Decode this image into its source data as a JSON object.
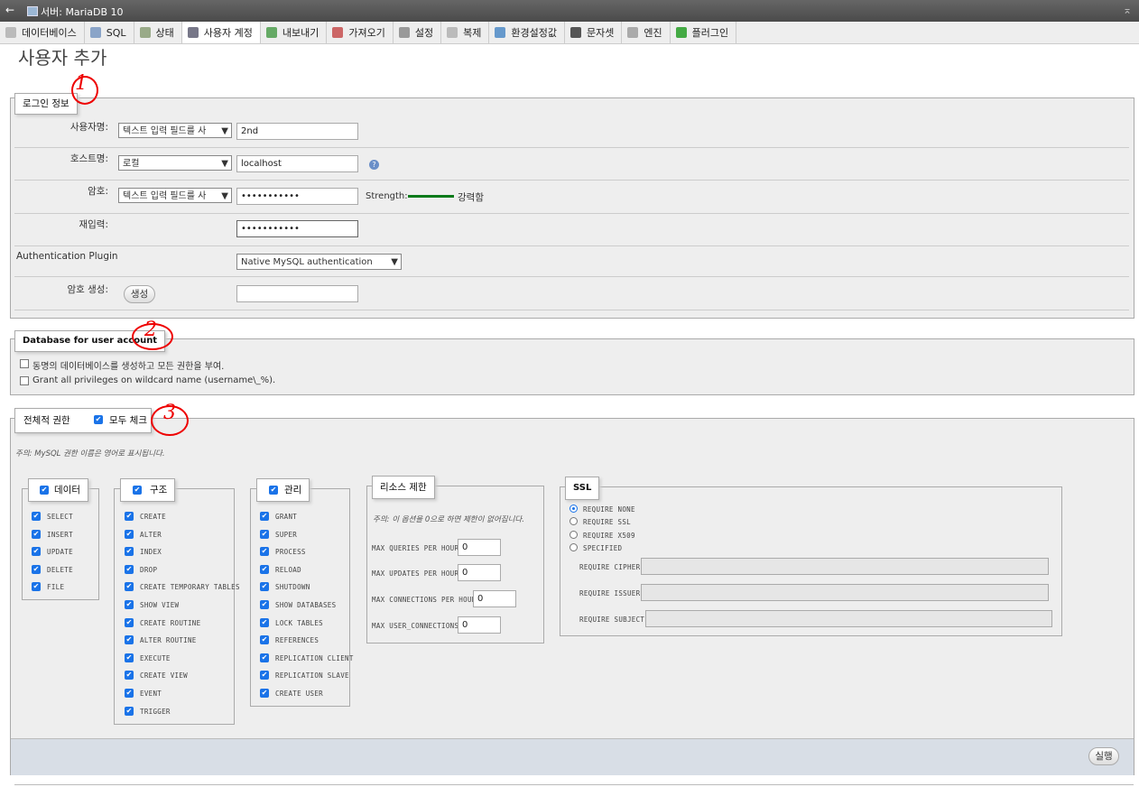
{
  "topbar": {
    "back": "←",
    "server": "서버: MariaDB 10",
    "collapse": "⌅"
  },
  "tabs": [
    {
      "label": "데이터베이스",
      "icon": "database-icon",
      "color": "#bbb"
    },
    {
      "label": "SQL",
      "icon": "sql-icon",
      "color": "#8aa4c8"
    },
    {
      "label": "상태",
      "icon": "status-icon",
      "color": "#9a8"
    },
    {
      "label": "사용자 계정",
      "icon": "users-icon",
      "color": "#778"
    },
    {
      "label": "내보내기",
      "icon": "export-icon",
      "color": "#6a6"
    },
    {
      "label": "가져오기",
      "icon": "import-icon",
      "color": "#c66"
    },
    {
      "label": "설정",
      "icon": "wrench-icon",
      "color": "#999"
    },
    {
      "label": "복제",
      "icon": "replication-icon",
      "color": "#bbb"
    },
    {
      "label": "환경설정값",
      "icon": "variables-icon",
      "color": "#69c"
    },
    {
      "label": "문자셋",
      "icon": "charset-icon",
      "color": "#555"
    },
    {
      "label": "엔진",
      "icon": "engine-icon",
      "color": "#aaa"
    },
    {
      "label": "플러그인",
      "icon": "plugin-icon",
      "color": "#4a4"
    }
  ],
  "page_title": "사용자 추가",
  "login": {
    "legend": "로그인 정보",
    "username_label": "사용자명:",
    "username_select": "텍스트 입력 필드를 사",
    "username_value": "2nd",
    "host_label": "호스트명:",
    "host_select": "로컬",
    "host_value": "localhost",
    "password_label": "암호:",
    "password_select": "텍스트 입력 필드를 사",
    "password_value": "•••••••••••",
    "strength_label": "Strength:",
    "strength_text": "강력함",
    "retype_label": "재입력:",
    "retype_value": "•••••••••••",
    "auth_label": "Authentication Plugin",
    "auth_select": "Native MySQL authentication",
    "genpw_label": "암호 생성:",
    "genpw_button": "생성",
    "genpw_value": ""
  },
  "dbsection": {
    "legend": "Database for user account",
    "opt1": "동명의 데이터베이스를 생성하고 모든 권한을 부여.",
    "opt2": "Grant all privileges on wildcard name (username\\_%)."
  },
  "global": {
    "legend": "전체적 권한",
    "checkall": "모두 체크",
    "note": "주의: MySQL 권한 이름은 영어로 표시됩니다."
  },
  "data_group": {
    "title": "데이터",
    "items": [
      "SELECT",
      "INSERT",
      "UPDATE",
      "DELETE",
      "FILE"
    ]
  },
  "structure_group": {
    "title": "구조",
    "items": [
      "CREATE",
      "ALTER",
      "INDEX",
      "DROP",
      "CREATE TEMPORARY TABLES",
      "SHOW VIEW",
      "CREATE ROUTINE",
      "ALTER ROUTINE",
      "EXECUTE",
      "CREATE VIEW",
      "EVENT",
      "TRIGGER"
    ]
  },
  "admin_group": {
    "title": "관리",
    "items": [
      "GRANT",
      "SUPER",
      "PROCESS",
      "RELOAD",
      "SHUTDOWN",
      "SHOW DATABASES",
      "LOCK TABLES",
      "REFERENCES",
      "REPLICATION CLIENT",
      "REPLICATION SLAVE",
      "CREATE USER"
    ]
  },
  "resource": {
    "title": "리소스 제한",
    "note": "주의: 이 옵션을 0으로 하면 제한이 없어집니다.",
    "rows": [
      {
        "label": "MAX QUERIES PER HOUR",
        "value": "0"
      },
      {
        "label": "MAX UPDATES PER HOUR",
        "value": "0"
      },
      {
        "label": "MAX CONNECTIONS PER HOUR",
        "value": "0"
      },
      {
        "label": "MAX USER_CONNECTIONS",
        "value": "0"
      }
    ]
  },
  "ssl": {
    "title": "SSL",
    "options": [
      "REQUIRE NONE",
      "REQUIRE SSL",
      "REQUIRE X509",
      "SPECIFIED"
    ],
    "fields": [
      "REQUIRE CIPHER",
      "REQUIRE ISSUER",
      "REQUIRE SUBJECT"
    ]
  },
  "submit": "실행",
  "annotations": [
    "1",
    "2",
    "3"
  ],
  "colors": {
    "accent": "#1a73e8",
    "strength": "#0a7a1a",
    "annotation": "#e00000"
  }
}
